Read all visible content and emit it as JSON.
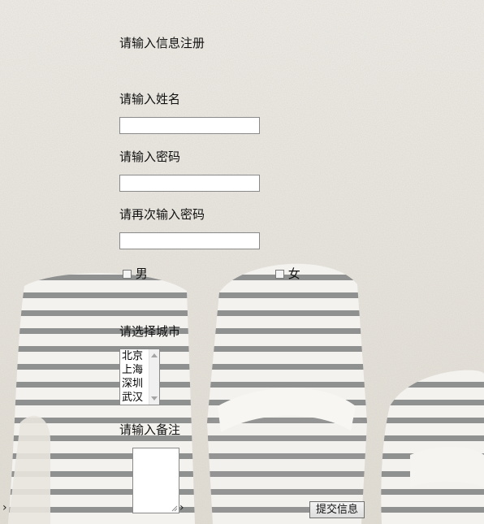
{
  "form": {
    "title": "请输入信息注册",
    "name_label": "请输入姓名",
    "name_value": "",
    "password_label": "请输入密码",
    "password_value": "",
    "password_confirm_label": "请再次输入密码",
    "password_confirm_value": "",
    "gender": {
      "male_label": "男",
      "female_label": "女"
    },
    "city_label": "请选择城市",
    "city_options": [
      "北京",
      "上海",
      "深圳",
      "武汉"
    ],
    "remarks_label": "请输入备注",
    "remarks_value": "",
    "submit_label": "提交信息"
  },
  "icons": {
    "left_marker": "chevron-right-icon",
    "textarea_marker": "chevron-right-icon"
  },
  "colors": {
    "page_background": "#ece8e0",
    "stripe": "#8e8e8e"
  }
}
